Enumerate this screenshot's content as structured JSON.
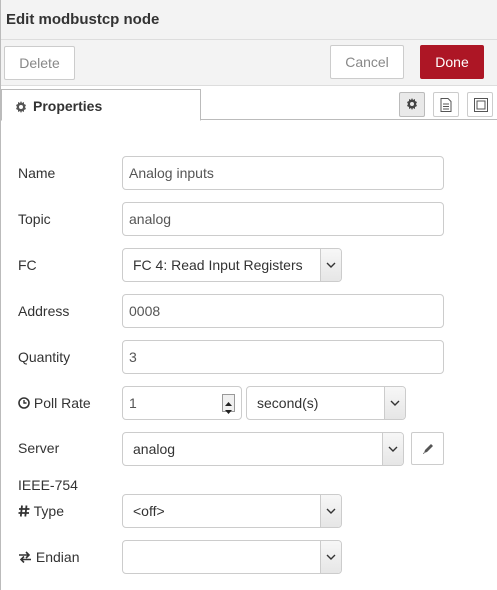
{
  "header": {
    "title": "Edit modbustcp node"
  },
  "toolbar": {
    "delete_label": "Delete",
    "cancel_label": "Cancel",
    "done_label": "Done"
  },
  "tabs": [
    {
      "label": "Properties",
      "icon": "gear-icon"
    }
  ],
  "tab_icons": [
    "gear-icon",
    "document-icon",
    "frame-icon"
  ],
  "form": {
    "name": {
      "label": "Name",
      "value": "Analog inputs"
    },
    "topic": {
      "label": "Topic",
      "value": "analog"
    },
    "fc": {
      "label": "FC",
      "value": "FC 4: Read Input Registers"
    },
    "address": {
      "label": "Address",
      "value": "0008"
    },
    "quantity": {
      "label": "Quantity",
      "value": "3"
    },
    "poll_rate": {
      "label": "Poll Rate",
      "value": "1",
      "unit": "second(s)",
      "icon": "clock-icon"
    },
    "server": {
      "label": "Server",
      "value": "analog",
      "edit_icon": "pencil-icon"
    },
    "ieee_section": {
      "label": "IEEE-754"
    },
    "type": {
      "label": "Type",
      "value": "<off>",
      "icon": "hash-icon"
    },
    "endian": {
      "label": "Endian",
      "value": "",
      "icon": "exchange-icon"
    }
  },
  "colors": {
    "done_bg": "#ad1625",
    "header_bg": "#f3f3f3"
  }
}
